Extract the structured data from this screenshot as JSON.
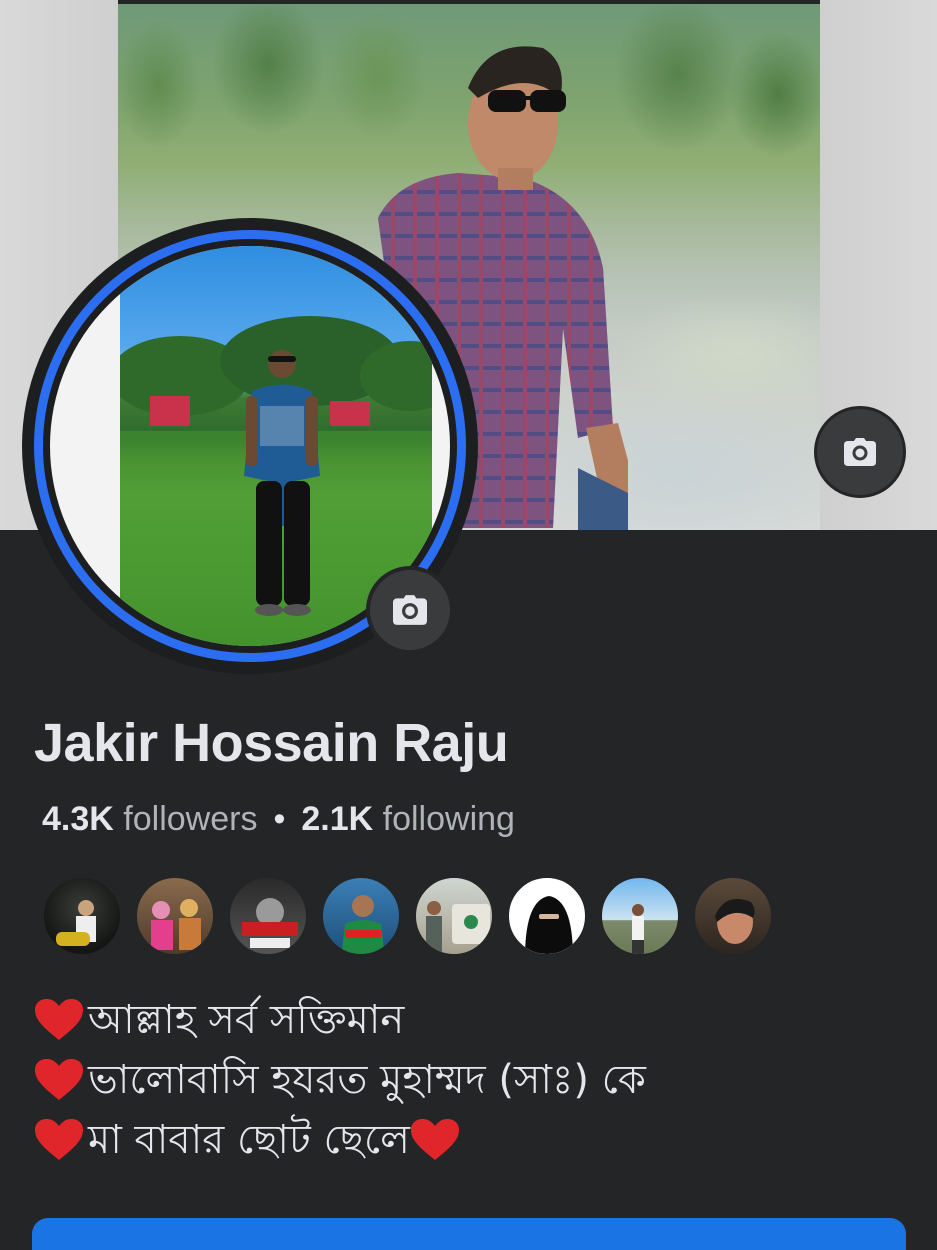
{
  "profile": {
    "name": "Jakir Hossain Raju",
    "followers_count": "4.3K",
    "followers_label": "followers",
    "separator": "•",
    "following_count": "2.1K",
    "following_label": "following"
  },
  "bio": [
    {
      "icon": "heart-icon",
      "text": "আল্লাহ সর্ব সক্তিমান"
    },
    {
      "icon": "heart-icon",
      "text": "ভালোবাসি হযরত মুহাম্মদ (সাঃ) কে"
    },
    {
      "icon": "heart-icon",
      "text": "মা বাবার ছোট ছেলে",
      "trailing_icon": "heart-icon"
    }
  ],
  "icons": {
    "cover_camera": "camera-icon",
    "avatar_camera": "camera-icon"
  },
  "friends_count_shown": 8,
  "colors": {
    "background": "#242526",
    "accent_ring": "#2b6ef2",
    "primary_button": "#1b74e4",
    "heart": "#e0262b",
    "text_primary": "#e4e6eb",
    "text_secondary": "#b0b3b8"
  }
}
